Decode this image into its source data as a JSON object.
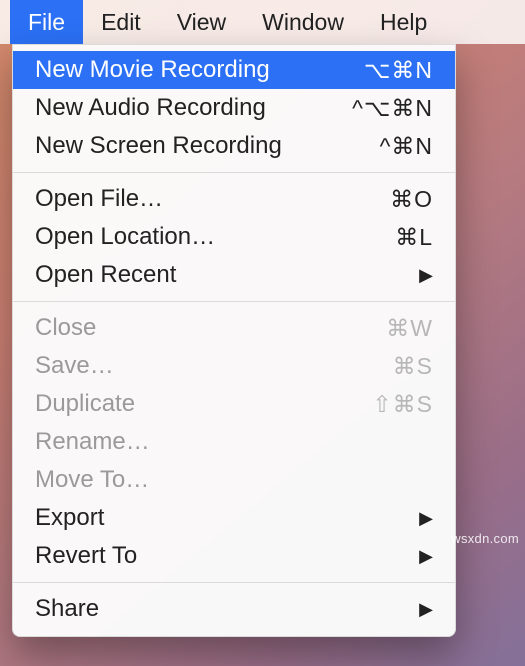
{
  "menubar": {
    "items": [
      {
        "label": "File",
        "active": true
      },
      {
        "label": "Edit",
        "active": false
      },
      {
        "label": "View",
        "active": false
      },
      {
        "label": "Window",
        "active": false
      },
      {
        "label": "Help",
        "active": false
      }
    ]
  },
  "menu": {
    "groups": [
      [
        {
          "id": "new-movie-recording",
          "label": "New Movie Recording",
          "shortcut": "⌥⌘N",
          "submenu": false,
          "highlight": true,
          "disabled": false
        },
        {
          "id": "new-audio-recording",
          "label": "New Audio Recording",
          "shortcut": "^⌥⌘N",
          "submenu": false,
          "highlight": false,
          "disabled": false
        },
        {
          "id": "new-screen-recording",
          "label": "New Screen Recording",
          "shortcut": "^⌘N",
          "submenu": false,
          "highlight": false,
          "disabled": false
        }
      ],
      [
        {
          "id": "open-file",
          "label": "Open File…",
          "shortcut": "⌘O",
          "submenu": false,
          "highlight": false,
          "disabled": false
        },
        {
          "id": "open-location",
          "label": "Open Location…",
          "shortcut": "⌘L",
          "submenu": false,
          "highlight": false,
          "disabled": false
        },
        {
          "id": "open-recent",
          "label": "Open Recent",
          "shortcut": "",
          "submenu": true,
          "highlight": false,
          "disabled": false
        }
      ],
      [
        {
          "id": "close",
          "label": "Close",
          "shortcut": "⌘W",
          "submenu": false,
          "highlight": false,
          "disabled": true
        },
        {
          "id": "save",
          "label": "Save…",
          "shortcut": "⌘S",
          "submenu": false,
          "highlight": false,
          "disabled": true
        },
        {
          "id": "duplicate",
          "label": "Duplicate",
          "shortcut": "⇧⌘S",
          "submenu": false,
          "highlight": false,
          "disabled": true
        },
        {
          "id": "rename",
          "label": "Rename…",
          "shortcut": "",
          "submenu": false,
          "highlight": false,
          "disabled": true
        },
        {
          "id": "move-to",
          "label": "Move To…",
          "shortcut": "",
          "submenu": false,
          "highlight": false,
          "disabled": true
        },
        {
          "id": "export",
          "label": "Export",
          "shortcut": "",
          "submenu": true,
          "highlight": false,
          "disabled": false
        },
        {
          "id": "revert-to",
          "label": "Revert To",
          "shortcut": "",
          "submenu": true,
          "highlight": false,
          "disabled": false
        }
      ],
      [
        {
          "id": "share",
          "label": "Share",
          "shortcut": "",
          "submenu": true,
          "highlight": false,
          "disabled": false
        }
      ]
    ]
  },
  "watermark": "wsxdn.com"
}
